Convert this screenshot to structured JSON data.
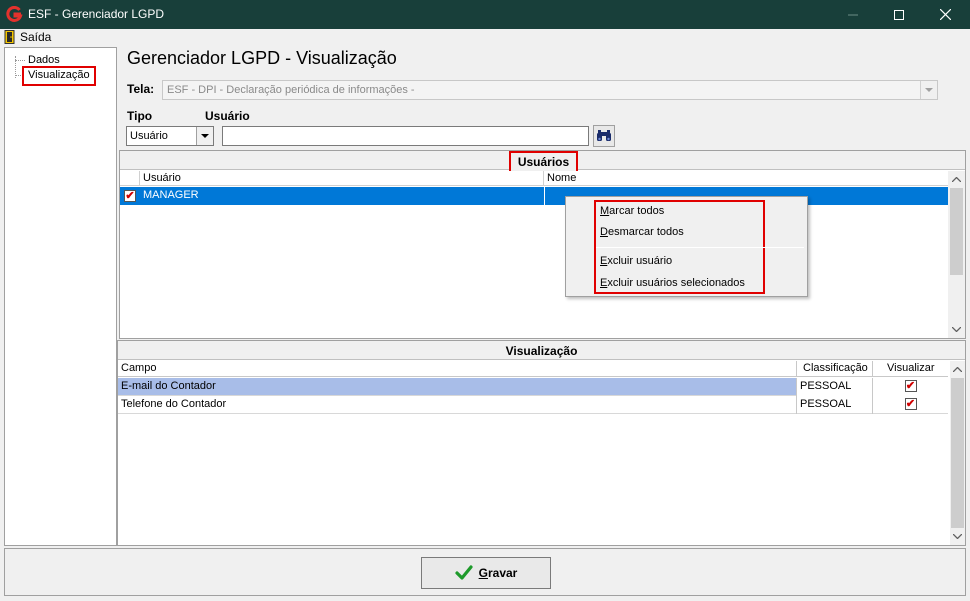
{
  "window": {
    "title": "ESF - Gerenciador LGPD",
    "minimize_icon": "minimize-icon",
    "maximize_icon": "maximize-icon",
    "close_icon": "close-icon"
  },
  "menu": {
    "saida": "Saída"
  },
  "tree": {
    "items": [
      "Dados",
      "Visualização"
    ]
  },
  "page": {
    "title": "Gerenciador LGPD - Visualização"
  },
  "filter": {
    "tela_label": "Tela:",
    "tela_value": "ESF - DPI - Declaração periódica de informações -",
    "tipo_label": "Tipo",
    "tipo_value": "Usuário",
    "usuario_label": "Usuário",
    "usuario_value": ""
  },
  "users_panel": {
    "title": "Usuários",
    "columns": [
      "Usuário",
      "Nome"
    ],
    "rows": [
      {
        "checked": true,
        "usuario": "MANAGER",
        "nome": ""
      }
    ]
  },
  "context_menu": {
    "items": [
      {
        "mnemonic": "M",
        "rest": "arcar todos"
      },
      {
        "mnemonic": "D",
        "rest": "esmarcar todos"
      },
      {
        "mnemonic": "E",
        "rest": "xcluir usuário"
      },
      {
        "mnemonic": "E",
        "rest": "xcluir usuários selecionados"
      }
    ]
  },
  "vis_panel": {
    "title": "Visualização",
    "columns": [
      "Campo",
      "Classificação",
      "Visualizar"
    ],
    "rows": [
      {
        "campo": "E-mail do Contador",
        "classificacao": "PESSOAL",
        "visualizar": true
      },
      {
        "campo": "Telefone do Contador",
        "classificacao": "PESSOAL",
        "visualizar": true
      }
    ]
  },
  "footer": {
    "gravar_mnemonic": "G",
    "gravar_rest": "ravar"
  },
  "colors": {
    "titlebar": "#183f3a",
    "selection": "#0078d7",
    "row_highlight": "#a8bde8",
    "annotation_red": "#e00000"
  }
}
